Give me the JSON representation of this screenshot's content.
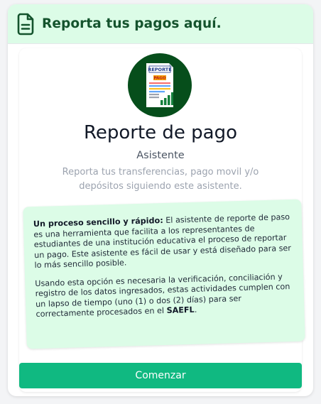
{
  "header": {
    "title": "Reporta tus pagos aquí.",
    "icon": "document-icon",
    "color": "#14532d",
    "background": "#dcfce7"
  },
  "logo": {
    "badge_top": "REPORTE",
    "badge_mid": "PAGO",
    "circle_color": "#064e1b"
  },
  "main": {
    "title": "Reporte de pago",
    "subtitle": "Asistente",
    "description": "Reporta tus transferencias, pago movil y/o depósitos siguiendo este asistente."
  },
  "info": {
    "p1_bold": "Un proceso sencillo y rápido:",
    "p1_text": " El asistente de reporte de paso es una herramienta que facilita a los representantes de estudiantes de una institución educativa el proceso de reportar un pago. Este asistente es fácil de usar y está diseñado para ser lo más sencillo posible.",
    "p2_text": "Usando esta opción es necesaria la verificación, conciliación y registro de los datos ingresados, estas actividades cumplen con un lapso de tiempo (uno (1) o dos (2) días) para ser correctamente procesados en el ",
    "p2_bold": "SAEFL",
    "p2_end": "."
  },
  "actions": {
    "begin_label": "Comenzar",
    "accent": "#10b981"
  }
}
